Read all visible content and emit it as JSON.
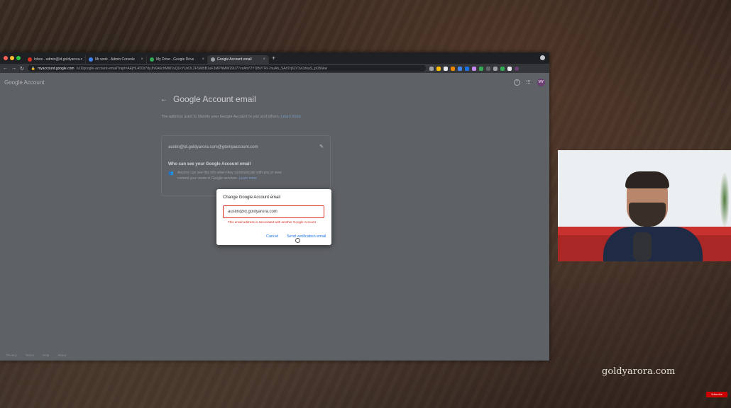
{
  "browser": {
    "tabs": [
      {
        "label": "Inbox - admin@id.goldyarora.c",
        "fav_color": "#d93025",
        "active": false
      },
      {
        "label": "Mr work - Admin Console",
        "fav_color": "#4285f4",
        "active": false
      },
      {
        "label": "My Drive - Google Drive",
        "fav_color": "#34a853",
        "active": false
      },
      {
        "label": "Google Account email",
        "fav_color": "#9aa0a6",
        "active": true
      }
    ],
    "new_tab": "+",
    "url_host": "myaccount.google.com",
    "url_path": "/u/1/google-account-email?rapt=AEjHL4D3r7dyJhXA6chMW1vQLkYUxOL2FSMBB1aF3MPNMW29U77vzAhY2YOBVTRl-7nuAh_SAd7q61V1vOzkaS_pO56kw"
  },
  "header": {
    "logo_google": "Google",
    "logo_account": "Account",
    "help": "?",
    "avatar_initials": "MY"
  },
  "main": {
    "title": "Google Account email",
    "description": "The address used to identify your Google Account to you and others.",
    "learn_more": "Learn more",
    "email": "austin@id.goldyarora.com@gtempaccount.com",
    "who_title": "Who can see your Google Account email",
    "who_desc": "Anyone can see this info when they communicate with you or view content you create in Google services.",
    "who_learn_more": "Learn more"
  },
  "footer": [
    "Privacy",
    "Terms",
    "Help",
    "About"
  ],
  "dialog": {
    "title": "Change Google Account email",
    "input_value": "austin@id.goldyarora.com",
    "error": "This email address is associated with another Google Account",
    "cancel": "Cancel",
    "send": "Send verification email"
  },
  "overlay": {
    "watermark": "goldyarora.com",
    "subscribe": "Subscribe"
  }
}
